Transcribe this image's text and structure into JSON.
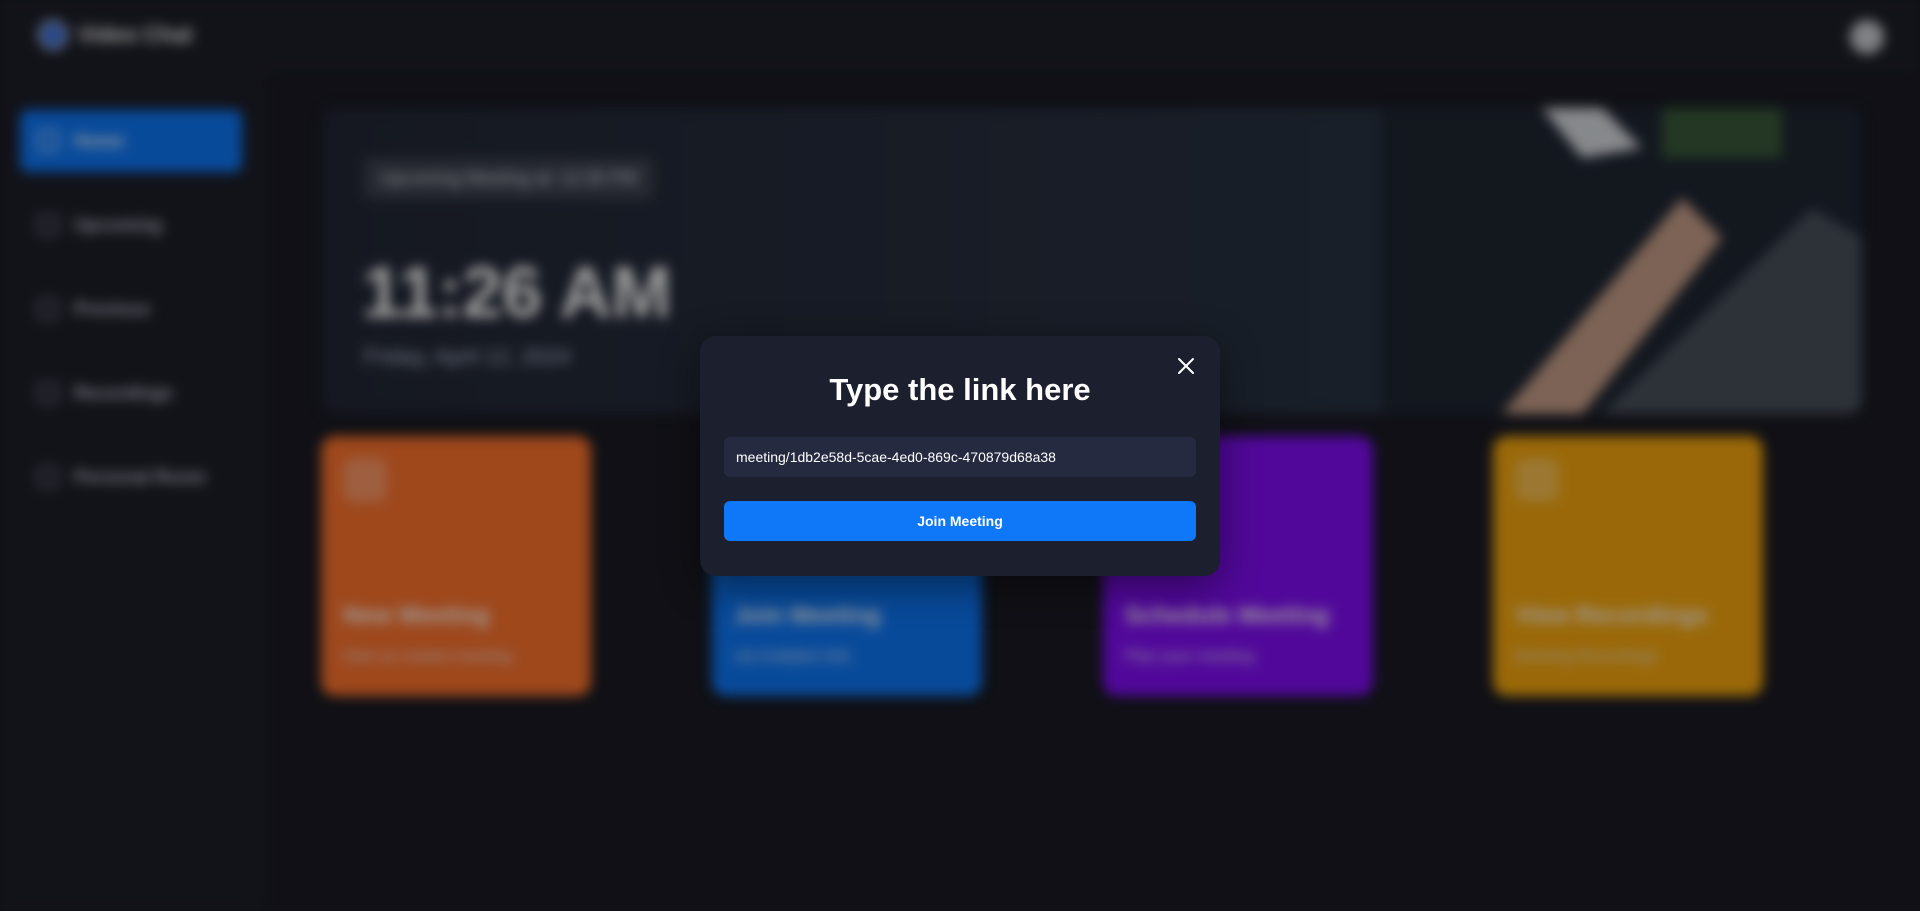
{
  "app": {
    "brand_name": "Video Chat",
    "colors": {
      "background": "#1a1b24",
      "panel": "#1e1f29",
      "accent": "#0e78f9"
    }
  },
  "sidebar": {
    "items": [
      {
        "label": "Home",
        "icon": "home-icon",
        "active": true
      },
      {
        "label": "Upcoming",
        "icon": "calendar-icon",
        "active": false
      },
      {
        "label": "Previous",
        "icon": "history-icon",
        "active": false
      },
      {
        "label": "Recordings",
        "icon": "video-icon",
        "active": false
      },
      {
        "label": "Personal Room",
        "icon": "add-user-icon",
        "active": false
      }
    ]
  },
  "hero": {
    "tag": "Upcoming Meeting at: 12:30 PM",
    "time": "11:26 AM",
    "date": "Friday, April 12, 2024"
  },
  "cards": [
    {
      "title": "New Meeting",
      "subtitle": "Start an instant meeting",
      "icon": "plus-icon",
      "color": "#ff742e"
    },
    {
      "title": "Join Meeting",
      "subtitle": "via invitation link",
      "icon": "user-add-icon",
      "color": "#0e78f9"
    },
    {
      "title": "Schedule Meeting",
      "subtitle": "Plan your meeting",
      "icon": "calendar-icon",
      "color": "#830ef9"
    },
    {
      "title": "View Recordings",
      "subtitle": "Meeting Recordings",
      "icon": "video-icon",
      "color": "#f9a90e"
    }
  ],
  "modal": {
    "title": "Type the link here",
    "input_value": "meeting/1db2e58d-5cae-4ed0-869c-470879d68a38",
    "button_label": "Join Meeting",
    "close_icon": "close-icon"
  }
}
